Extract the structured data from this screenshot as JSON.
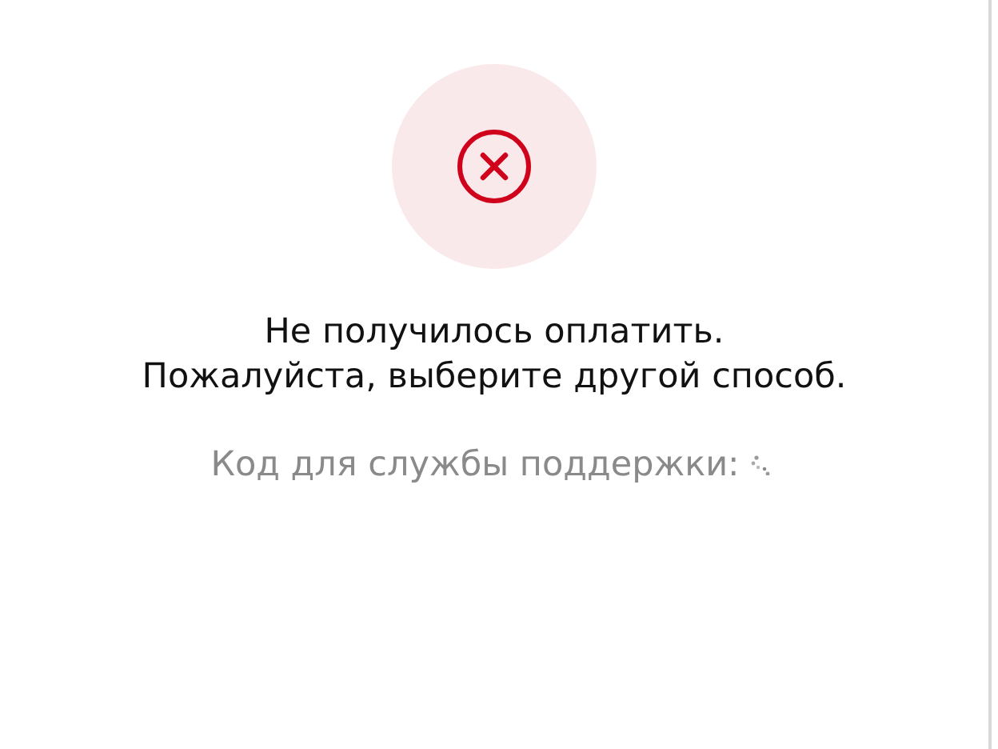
{
  "status_icon": {
    "kind": "error"
  },
  "message_lines": [
    "Не получилось оплатить.",
    "Пожалуйста, выберите другой способ."
  ],
  "support": {
    "label": "Код для службы поддержки:",
    "loading": true
  }
}
